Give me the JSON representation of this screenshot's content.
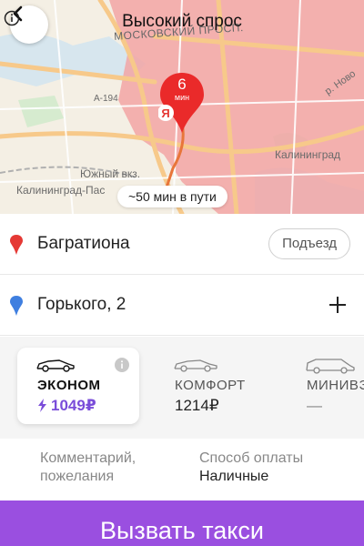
{
  "header": {
    "title": "Высокий спрос",
    "back_icon": "chevron-left-icon",
    "info_icon": "info-icon"
  },
  "map": {
    "labels": {
      "street_moskovsky": "МОСКОВСКИЙ ПРОСП.",
      "road_a194": "А-194",
      "station_south": "Южный вкз.",
      "station_pass": "Калининград-Пас",
      "city": "Калининград",
      "road_r": "р. Ново"
    },
    "pin": {
      "minutes": "6",
      "unit": "мин",
      "brand": "Я"
    },
    "travel_time": "~50 мин в пути",
    "colors": {
      "surge_zone": "#f2a5a5",
      "route": "#f0a06a",
      "pin": "#ea2a2a"
    }
  },
  "route": {
    "from": "Багратиона",
    "to": "Горького, 2",
    "entrance_label": "Подъезд",
    "colors": {
      "from_marker": "#e53935",
      "to_marker": "#3f7fe0"
    }
  },
  "tariffs": [
    {
      "name": "ЭКОНОМ",
      "price": "1049₽",
      "selected": true,
      "surge": true
    },
    {
      "name": "КОМФОРТ",
      "price": "1214₽",
      "selected": false
    },
    {
      "name": "МИНИВЭ",
      "price": "—",
      "selected": false
    }
  ],
  "options": {
    "comment_label": "Комментарий, пожелания",
    "comment_line1": "Комментарий,",
    "comment_line2": "пожелания",
    "payment_label": "Способ оплаты",
    "payment_value": "Наличные"
  },
  "order": {
    "label": "Вызвать такси",
    "color": "#9a4fe0"
  }
}
